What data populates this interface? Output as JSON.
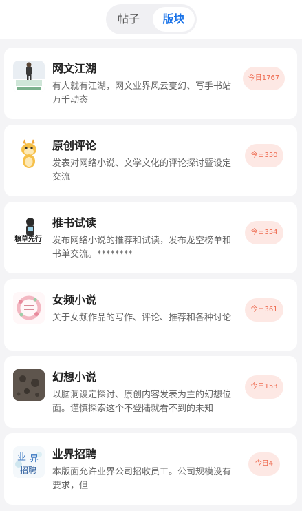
{
  "tabs": {
    "posts": "帖子",
    "boards": "版块"
  },
  "boards": [
    {
      "title": "网文江湖",
      "desc": "有人就有江湖，网文业界风云变幻、写手书站万千动态",
      "badge": "今日1767",
      "icon": "stage-speaker-icon"
    },
    {
      "title": "原创评论",
      "desc": "发表对网络小说、文学文化的评论探讨暨设定交流",
      "badge": "今日350",
      "icon": "dragon-mascot-icon"
    },
    {
      "title": "推书试读",
      "desc": "发布网络小说的推荐和试读，发布龙空榜单和书单交流。********",
      "badge": "今日354",
      "icon": "reader-mascot-icon"
    },
    {
      "title": "女频小说",
      "desc": "关于女频作品的写作、评论、推荐和各种讨论",
      "badge": "今日361",
      "icon": "floral-wreath-icon"
    },
    {
      "title": "幻想小说",
      "desc": "以脑洞设定探讨、原创内容发表为主的幻想位面。谨慎探索这个不登陆就看不到的未知",
      "badge": "今日153",
      "icon": "moon-surface-icon"
    },
    {
      "title": "业界招聘",
      "desc": "本版面允许业界公司招收员工。公司规模没有要求，但",
      "badge": "今日4",
      "icon": "recruit-calligraphy-icon"
    }
  ],
  "colors": {
    "accent": "#1a73e8",
    "badge_bg": "#fde8e4",
    "badge_text": "#ee6a4f"
  }
}
